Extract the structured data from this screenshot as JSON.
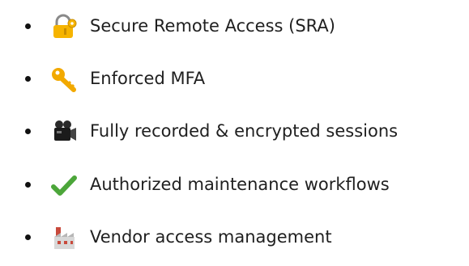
{
  "features": {
    "items": [
      {
        "icon": "locked-with-key-icon",
        "label": "Secure Remote Access (SRA)"
      },
      {
        "icon": "key-icon",
        "label": "Enforced MFA"
      },
      {
        "icon": "movie-camera-icon",
        "label": "Fully recorded & encrypted sessions"
      },
      {
        "icon": "check-mark-icon",
        "label": "Authorized maintenance workflows",
        "color": "#4CA63A"
      },
      {
        "icon": "factory-icon",
        "label": "Vendor access management"
      }
    ]
  },
  "colors": {
    "lock_body": "#F6B400",
    "key": "#F2A900",
    "camera": "#1B1B1B",
    "check": "#4CA63A",
    "factory_wall": "#D8D8D8",
    "factory_accent": "#C84A3C"
  }
}
